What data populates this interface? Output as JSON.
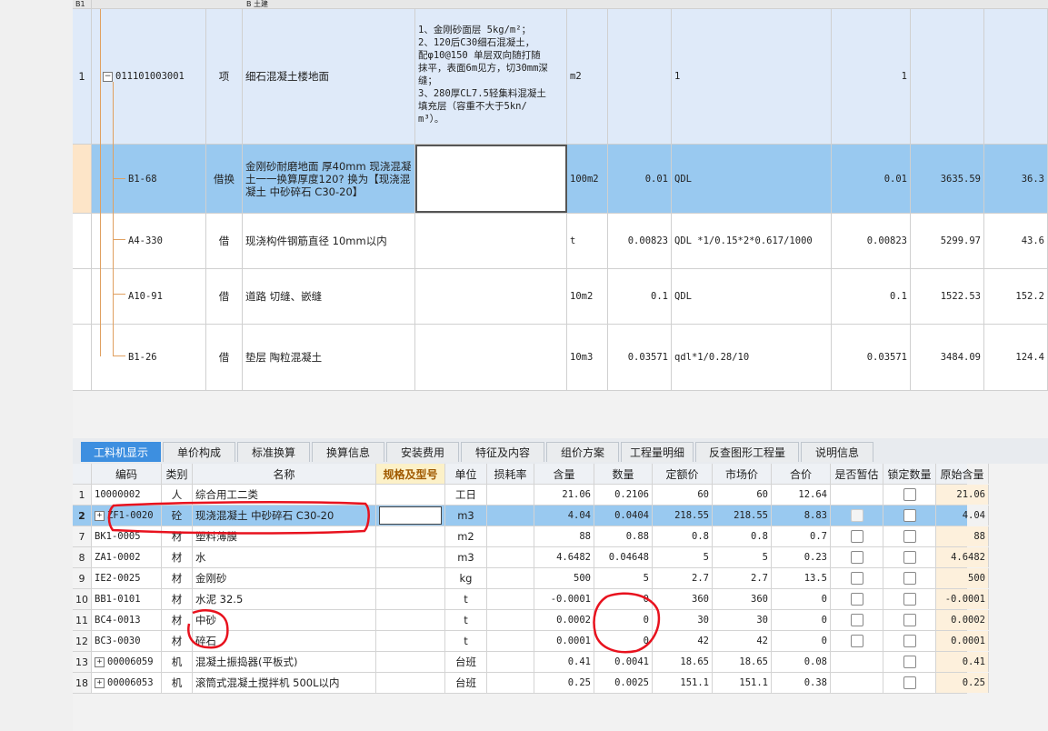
{
  "upper_table": {
    "partial_header": {
      "row_no": "B1",
      "text": "B 土建"
    },
    "rows": [
      {
        "no": "1",
        "code": "011101003001",
        "type": "项",
        "name": "细石混凝土楼地面",
        "feature": "1、金刚砂面层 5kg/m²；\n2、120后C30细石混凝土，\n配φ10@150 单层双向随打随\n抹平，表面6m见方，切30mm深\n缝；\n3、280厚CL7.5轻集料混凝土\n填充层（容重不大于5kn/\nm³）。",
        "unit": "m2",
        "content": "",
        "expr": "1",
        "qty": "1",
        "price": "",
        "total": ""
      },
      {
        "no": "",
        "code": "B1-68",
        "type": "借换",
        "name": "金刚砂耐磨地面 厚40mm 现浇混凝土一一换算厚度120?  换为【现浇混凝土 中砂碎石 C30-20】",
        "feature": "",
        "unit": "100m2",
        "content": "0.01",
        "expr": "QDL",
        "qty": "0.01",
        "price": "3635.59",
        "total": "36.3"
      },
      {
        "no": "",
        "code": "A4-330",
        "type": "借",
        "name": "现浇构件钢筋直径 10mm以内",
        "feature": "",
        "unit": "t",
        "content": "0.00823",
        "expr": "QDL *1/0.15*2*0.617/1000",
        "qty": "0.00823",
        "price": "5299.97",
        "total": "43.6"
      },
      {
        "no": "",
        "code": "A10-91",
        "type": "借",
        "name": "道路 切缝、嵌缝",
        "feature": "",
        "unit": "10m2",
        "content": "0.1",
        "expr": "QDL",
        "qty": "0.1",
        "price": "1522.53",
        "total": "152.2"
      },
      {
        "no": "",
        "code": "B1-26",
        "type": "借",
        "name": "垫层 陶粒混凝土",
        "feature": "",
        "unit": "10m3",
        "content": "0.03571",
        "expr": "qdl*1/0.28/10",
        "qty": "0.03571",
        "price": "3484.09",
        "total": "124.4"
      }
    ]
  },
  "tabs": [
    "工料机显示",
    "单价构成",
    "标准换算",
    "换算信息",
    "安装费用",
    "特征及内容",
    "组价方案",
    "工程量明细",
    "反查图形工程量",
    "说明信息"
  ],
  "grid": {
    "headers": [
      "编码",
      "类别",
      "名称",
      "规格及型号",
      "单位",
      "损耗率",
      "含量",
      "数量",
      "定额价",
      "市场价",
      "合价",
      "是否暂估",
      "锁定数量",
      "原始含量"
    ],
    "rows": [
      {
        "rn": "1",
        "code": "10000002",
        "cat": "人",
        "name": "综合用工二类",
        "unit": "工日",
        "loss": "",
        "content": "21.06",
        "qty": "0.2106",
        "dprice": "60",
        "mprice": "60",
        "total": "12.64",
        "est": false,
        "lock": true,
        "orig": "21.06"
      },
      {
        "rn": "2",
        "code": "ZF1-0020",
        "cat": "砼",
        "name": "现浇混凝土 中砂碎石 C30-20",
        "unit": "m3",
        "loss": "",
        "content": "4.04",
        "qty": "0.0404",
        "dprice": "218.55",
        "mprice": "218.55",
        "total": "8.83",
        "est": true,
        "lock": true,
        "orig": "4.04",
        "expand": true
      },
      {
        "rn": "7",
        "code": "BK1-0005",
        "cat": "材",
        "name": "塑料薄膜",
        "unit": "m2",
        "loss": "",
        "content": "88",
        "qty": "0.88",
        "dprice": "0.8",
        "mprice": "0.8",
        "total": "0.7",
        "est": true,
        "lock": true,
        "orig": "88"
      },
      {
        "rn": "8",
        "code": "ZA1-0002",
        "cat": "材",
        "name": "水",
        "unit": "m3",
        "loss": "",
        "content": "4.6482",
        "qty": "0.04648",
        "dprice": "5",
        "mprice": "5",
        "total": "0.23",
        "est": true,
        "lock": true,
        "orig": "4.6482"
      },
      {
        "rn": "9",
        "code": "IE2-0025",
        "cat": "材",
        "name": "金刚砂",
        "unit": "kg",
        "loss": "",
        "content": "500",
        "qty": "5",
        "dprice": "2.7",
        "mprice": "2.7",
        "total": "13.5",
        "est": true,
        "lock": true,
        "orig": "500"
      },
      {
        "rn": "10",
        "code": "BB1-0101",
        "cat": "材",
        "name": "水泥 32.5",
        "unit": "t",
        "loss": "",
        "content": "-0.0001",
        "qty": "0",
        "dprice": "360",
        "mprice": "360",
        "total": "0",
        "est": true,
        "lock": true,
        "orig": "-0.0001"
      },
      {
        "rn": "11",
        "code": "BC4-0013",
        "cat": "材",
        "name": "中砂",
        "unit": "t",
        "loss": "",
        "content": "0.0002",
        "qty": "0",
        "dprice": "30",
        "mprice": "30",
        "total": "0",
        "est": true,
        "lock": true,
        "orig": "0.0002"
      },
      {
        "rn": "12",
        "code": "BC3-0030",
        "cat": "材",
        "name": "碎石",
        "unit": "t",
        "loss": "",
        "content": "0.0001",
        "qty": "0",
        "dprice": "42",
        "mprice": "42",
        "total": "0",
        "est": true,
        "lock": true,
        "orig": "0.0001"
      },
      {
        "rn": "13",
        "code": "00006059",
        "cat": "机",
        "name": "混凝土振捣器(平板式)",
        "unit": "台班",
        "loss": "",
        "content": "0.41",
        "qty": "0.0041",
        "dprice": "18.65",
        "mprice": "18.65",
        "total": "0.08",
        "est": false,
        "lock": true,
        "orig": "0.41",
        "expand": true
      },
      {
        "rn": "18",
        "code": "00006053",
        "cat": "机",
        "name": "滚筒式混凝土搅拌机 500L以内",
        "unit": "台班",
        "loss": "",
        "content": "0.25",
        "qty": "0.0025",
        "dprice": "151.1",
        "mprice": "151.1",
        "total": "0.38",
        "est": false,
        "lock": true,
        "orig": "0.25",
        "expand": true
      }
    ]
  },
  "annotation_color": "#e8121e"
}
